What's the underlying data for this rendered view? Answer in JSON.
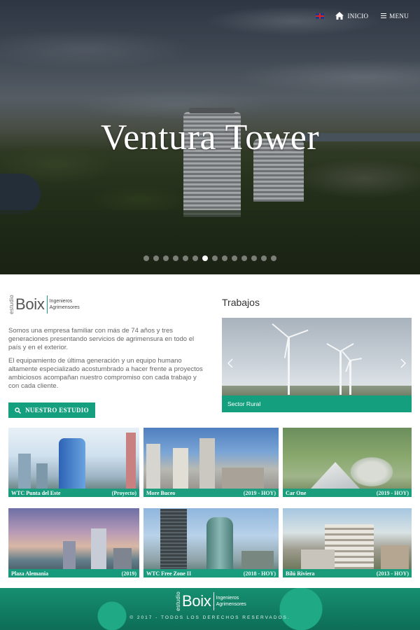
{
  "nav": {
    "language_flag": "uk-flag-icon",
    "home_icon": "home-icon",
    "inicio_label": "INICIO",
    "menu_icon": "hamburger-menu-icon",
    "menu_label": "MENU"
  },
  "hero": {
    "title": "Ventura Tower",
    "dot_count": 14,
    "active_dot": 6
  },
  "logo": {
    "estudio": "estudio",
    "boix": "Boix",
    "line1": "Ingenieros",
    "line2": "Agrimensores"
  },
  "intro": {
    "p1": "Somos una empresa familiar con más de 74 años y tres generaciones presentando servicios de agrimensura en todo el país y en el exterior.",
    "p2": "El equipamiento de última generación y un equipo humano altamente especializado acostumbrado a hacer frente a proyectos ambiciosos acompañan nuestro compromiso con cada trabajo y con cada cliente.",
    "button_label": "NUESTRO ESTUDIO",
    "button_icon": "search-icon"
  },
  "trabajos": {
    "title": "Trabajos",
    "slide_caption": "Sector Rural",
    "prev_icon": "chevron-left-icon",
    "next_icon": "chevron-right-icon"
  },
  "projects": [
    {
      "name": "WTC Punta del Este",
      "year": "(Proyecto)"
    },
    {
      "name": "More Buceo",
      "year": "(2019 - HOY)"
    },
    {
      "name": "Car One",
      "year": "(2019 - HOY)"
    },
    {
      "name": "Plaza Alemania",
      "year": "(2019)"
    },
    {
      "name": "WTC Free Zone II",
      "year": "(2018 - HOY)"
    },
    {
      "name": "Bilú Riviera",
      "year": "(2013 - HOY)"
    }
  ],
  "footer": {
    "copyright": "© 2017 - TODOS LOS DERECHOS RESERVADOS."
  },
  "colors": {
    "accent": "#14a07e",
    "footer": "#0d6d56"
  }
}
